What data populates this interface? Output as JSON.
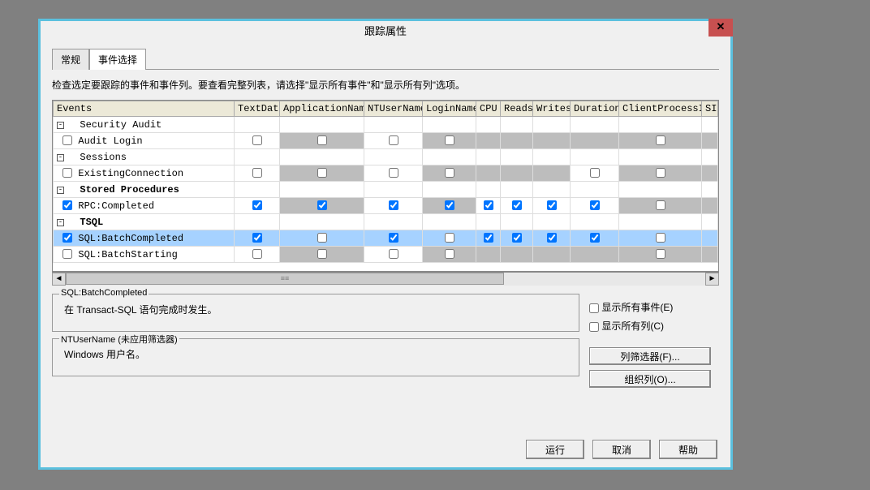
{
  "title": "跟踪属性",
  "tabs": {
    "general": "常规",
    "events": "事件选择"
  },
  "instruction": "检查选定要跟踪的事件和事件列。要查看完整列表，请选择\"显示所有事件\"和\"显示所有列\"选项。",
  "columns": [
    "Events",
    "TextData",
    "ApplicationName",
    "NTUserName",
    "LoginName",
    "CPU",
    "Reads",
    "Writes",
    "Duration",
    "ClientProcessID",
    "SI"
  ],
  "rows": [
    {
      "type": "group",
      "label": "Security Audit",
      "bold": false
    },
    {
      "type": "event",
      "label": "Audit Login",
      "cells": {
        "TextData": {
          "chk": false
        },
        "ApplicationName": {
          "gray": true,
          "chk": false
        },
        "NTUserName": {
          "chk": false
        },
        "LoginName": {
          "gray": true,
          "chk": false
        },
        "CPU": {
          "gray": true
        },
        "Reads": {
          "gray": true
        },
        "Writes": {
          "gray": true
        },
        "Duration": {
          "gray": true
        },
        "ClientProcessID": {
          "gray": true,
          "chk": false
        }
      },
      "evchk": false
    },
    {
      "type": "group",
      "label": "Sessions",
      "bold": false
    },
    {
      "type": "event",
      "label": "ExistingConnection",
      "cells": {
        "TextData": {
          "chk": false
        },
        "ApplicationName": {
          "gray": true,
          "chk": false
        },
        "NTUserName": {
          "chk": false
        },
        "LoginName": {
          "gray": true,
          "chk": false
        },
        "CPU": {
          "gray": true
        },
        "Reads": {
          "gray": true
        },
        "Writes": {
          "gray": true
        },
        "Duration": {
          "chk": false
        },
        "ClientProcessID": {
          "gray": true,
          "chk": false
        }
      },
      "evchk": false
    },
    {
      "type": "group",
      "label": "Stored Procedures",
      "bold": true
    },
    {
      "type": "event",
      "label": "RPC:Completed",
      "cells": {
        "TextData": {
          "chk": true
        },
        "ApplicationName": {
          "gray": true,
          "chk": true
        },
        "NTUserName": {
          "chk": true
        },
        "LoginName": {
          "gray": true,
          "chk": true
        },
        "CPU": {
          "chk": true
        },
        "Reads": {
          "chk": true
        },
        "Writes": {
          "chk": true
        },
        "Duration": {
          "chk": true
        },
        "ClientProcessID": {
          "gray": true,
          "chk": false
        }
      },
      "evchk": true
    },
    {
      "type": "group",
      "label": "TSQL",
      "bold": true
    },
    {
      "type": "event",
      "label": "SQL:BatchCompleted",
      "hl": true,
      "cells": {
        "TextData": {
          "chk": true
        },
        "ApplicationName": {
          "gray": true,
          "chk": false
        },
        "NTUserName": {
          "chk": true
        },
        "LoginName": {
          "gray": true,
          "chk": false
        },
        "CPU": {
          "chk": true
        },
        "Reads": {
          "chk": true
        },
        "Writes": {
          "chk": true
        },
        "Duration": {
          "chk": true
        },
        "ClientProcessID": {
          "gray": true,
          "chk": false
        }
      },
      "evchk": true
    },
    {
      "type": "event",
      "label": "SQL:BatchStarting",
      "cells": {
        "TextData": {
          "chk": false
        },
        "ApplicationName": {
          "gray": true,
          "chk": false
        },
        "NTUserName": {
          "chk": false
        },
        "LoginName": {
          "gray": true,
          "chk": false
        },
        "CPU": {
          "gray": true
        },
        "Reads": {
          "gray": true
        },
        "Writes": {
          "gray": true
        },
        "Duration": {
          "gray": true
        },
        "ClientProcessID": {
          "gray": true,
          "chk": false
        }
      },
      "evchk": false
    }
  ],
  "desc1": {
    "legend": "SQL:BatchCompleted",
    "text": "在 Transact-SQL 语句完成时发生。"
  },
  "desc2": {
    "legend": "NTUserName (未应用筛选器)",
    "text": "Windows 用户名。"
  },
  "opts": {
    "showAllEvents": "显示所有事件(E)",
    "showAllCols": "显示所有列(C)"
  },
  "btns": {
    "filter": "列筛选器(F)...",
    "organize": "组织列(O)...",
    "run": "运行",
    "cancel": "取消",
    "help": "帮助"
  }
}
